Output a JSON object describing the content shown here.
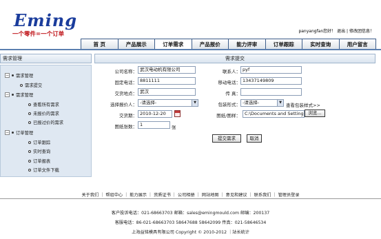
{
  "logo": {
    "text": "Eming",
    "slogan": "一个零件=一个订单"
  },
  "userbar": {
    "user_text": "panyangfan您好！",
    "logout": "退出",
    "divider": "|",
    "message": "修改团信息！"
  },
  "nav": [
    "首 页",
    "产品展示",
    "订单需求",
    "产品报价",
    "能力评审",
    "订单跟踪",
    "实时查询",
    "用户留言"
  ],
  "sidebar": {
    "title": "需求管理",
    "items": [
      {
        "label": "需求管理"
      },
      {
        "label": "需求提交"
      },
      {
        "label": "需求管理"
      },
      {
        "label": "查看所有需求"
      },
      {
        "label": "未报价的需求"
      },
      {
        "label": "已报过价的需求"
      },
      {
        "label": "订单管理"
      },
      {
        "label": "订单跟踪"
      },
      {
        "label": "实时查询"
      },
      {
        "label": "订单报表"
      },
      {
        "label": "订单文件下载"
      }
    ]
  },
  "form": {
    "title": "需求提交",
    "company_label": "公司名称：",
    "company_value": "武汉电动机有限公司",
    "contact_label": "联系人：",
    "contact_value": "pyf",
    "phone_label": "固定电话：",
    "phone_value": "8811111",
    "mobile_label": "移动电话：",
    "mobile_value": "13437149809",
    "place_label": "交货地点：",
    "place_value": "武汉",
    "fax_label": "传 真：",
    "fax_value": "",
    "quoter_label": "选择报价人：",
    "quoter_value": "-请选择-",
    "pack_label": "包装形式：",
    "pack_value": "-请选择-",
    "pack_link": "查看包装样式>>",
    "date_label": "交货期：",
    "date_value": "2010-12-20",
    "drawing_label": "图纸/图样：",
    "drawing_value": "C:\\Documents and Setting",
    "browse_label": "浏览...",
    "count_label": "图纸张数：",
    "count_value": "1",
    "count_unit": "张",
    "submit_label": "提交需求",
    "cancel_label": "取消"
  },
  "footer": {
    "links": "关于我们 ｜ 帮组中心 ｜ 能力展示 ｜ 资质证书 ｜ 公司相册 ｜ 网站地图 ｜ 意见和建议 ｜ 联系我们 ｜ 管理员登录",
    "line1": "客户投诉电话：021-68663703 邮箱：sales@emingmould.com 邮编：200137",
    "line2": "客服电话：86-021-68663703 58647688 58642099 传真：021-58646534",
    "line3": "上海益铭模具有限公司 Copyright © 2010-2012 ｜站长统计"
  }
}
